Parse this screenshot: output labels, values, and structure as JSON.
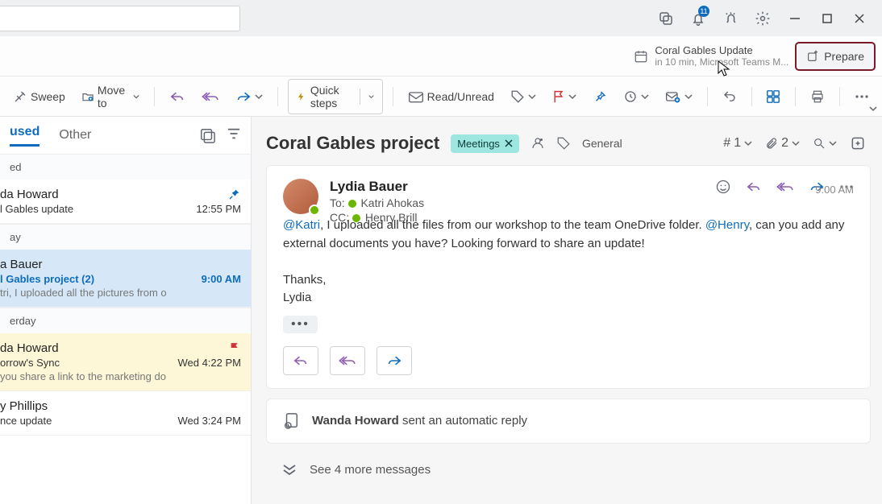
{
  "titlebar": {
    "notif_count": "11"
  },
  "reminder": {
    "title": "Coral Gables Update",
    "sub": "in 10 min, Microsoft Teams M...",
    "prepare": "Prepare"
  },
  "toolbar": {
    "sweep": "Sweep",
    "moveto": "Move to",
    "quicksteps": "Quick steps",
    "readunread": "Read/Unread"
  },
  "tabs": {
    "focused": "used",
    "other": "Other"
  },
  "groups": {
    "g1": "ed",
    "g2": "ay",
    "g3": "erday"
  },
  "messages": {
    "m1": {
      "from": "da Howard",
      "subject": "l Gables update",
      "time": "12:55 PM"
    },
    "m2": {
      "from": "a Bauer",
      "subject": "l Gables project  (2)",
      "time": "9:00 AM",
      "preview": "tri, I uploaded all the pictures from o"
    },
    "m3": {
      "from": "da Howard",
      "subject": "orrow's Sync",
      "time": "Wed 4:22 PM",
      "preview": "you share a link to the marketing do"
    },
    "m4": {
      "from": "y Phillips",
      "subject": "nce update",
      "time": "Wed 3:24 PM"
    }
  },
  "read": {
    "subject": "Coral Gables project",
    "tag": "Meetings",
    "cat": "General",
    "hash": "1",
    "attach": "2",
    "sender": "Lydia Bauer",
    "to_label": "To:",
    "to": "Katri Ahokas",
    "cc_label": "CC:",
    "cc": "Henry Brill",
    "time": "9:00 AM",
    "m1": "@Katri",
    "b1": ", I uploaded all the files from our workshop to the team OneDrive folder. ",
    "m2": "@Henry",
    "b2": ", can you add any external documents you have? Looking forward to share an update!",
    "thanks": "Thanks,",
    "sig": "Lydia",
    "auto1": "Wanda Howard",
    "auto2": " sent an automatic reply",
    "seemore": "See 4 more messages"
  }
}
